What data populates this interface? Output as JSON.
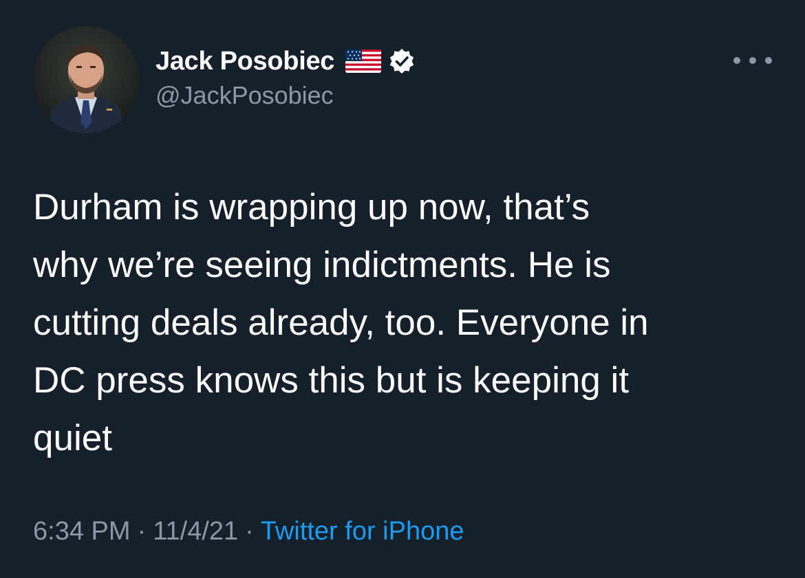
{
  "author": {
    "display_name": "Jack Posobiec",
    "handle": "@JackPosobiec",
    "name_emoji": "flag-us-icon",
    "verified": true
  },
  "tweet": {
    "text_lines": [
      "Durham is wrapping up now, that’s",
      "why we’re seeing indictments. He is",
      "cutting deals already, too. Everyone in",
      "DC press knows this but is keeping it",
      "quiet"
    ],
    "time": "6:34 PM",
    "date": "11/4/21",
    "separator": "·",
    "source": "Twitter for iPhone"
  },
  "icons": {
    "more": "more-horizontal-icon",
    "verified": "verified-badge-icon"
  },
  "colors": {
    "background": "#15202b",
    "primary_text": "#ffffff",
    "secondary_text": "#8b98a5",
    "link": "#1d9bf0"
  }
}
